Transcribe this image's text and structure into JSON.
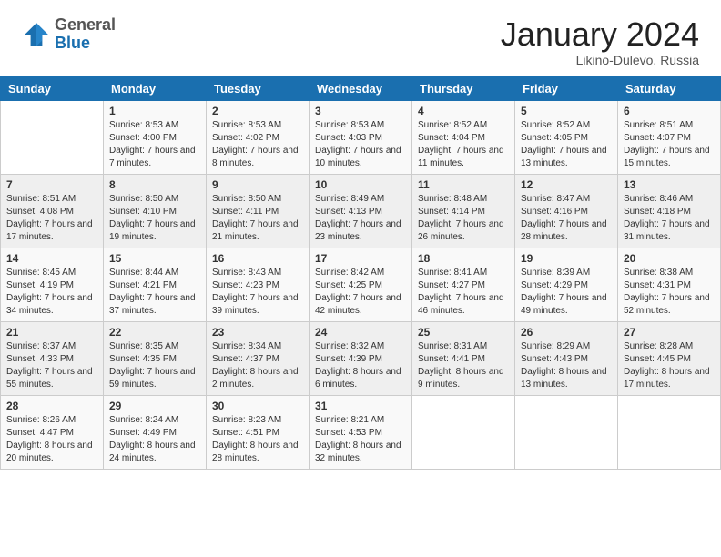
{
  "header": {
    "logo": {
      "general": "General",
      "blue": "Blue"
    },
    "title": "January 2024",
    "location": "Likino-Dulevo, Russia"
  },
  "days_of_week": [
    "Sunday",
    "Monday",
    "Tuesday",
    "Wednesday",
    "Thursday",
    "Friday",
    "Saturday"
  ],
  "weeks": [
    [
      {
        "day": "",
        "sunrise": "",
        "sunset": "",
        "daylight": ""
      },
      {
        "day": "1",
        "sunrise": "Sunrise: 8:53 AM",
        "sunset": "Sunset: 4:00 PM",
        "daylight": "Daylight: 7 hours and 7 minutes."
      },
      {
        "day": "2",
        "sunrise": "Sunrise: 8:53 AM",
        "sunset": "Sunset: 4:02 PM",
        "daylight": "Daylight: 7 hours and 8 minutes."
      },
      {
        "day": "3",
        "sunrise": "Sunrise: 8:53 AM",
        "sunset": "Sunset: 4:03 PM",
        "daylight": "Daylight: 7 hours and 10 minutes."
      },
      {
        "day": "4",
        "sunrise": "Sunrise: 8:52 AM",
        "sunset": "Sunset: 4:04 PM",
        "daylight": "Daylight: 7 hours and 11 minutes."
      },
      {
        "day": "5",
        "sunrise": "Sunrise: 8:52 AM",
        "sunset": "Sunset: 4:05 PM",
        "daylight": "Daylight: 7 hours and 13 minutes."
      },
      {
        "day": "6",
        "sunrise": "Sunrise: 8:51 AM",
        "sunset": "Sunset: 4:07 PM",
        "daylight": "Daylight: 7 hours and 15 minutes."
      }
    ],
    [
      {
        "day": "7",
        "sunrise": "Sunrise: 8:51 AM",
        "sunset": "Sunset: 4:08 PM",
        "daylight": "Daylight: 7 hours and 17 minutes."
      },
      {
        "day": "8",
        "sunrise": "Sunrise: 8:50 AM",
        "sunset": "Sunset: 4:10 PM",
        "daylight": "Daylight: 7 hours and 19 minutes."
      },
      {
        "day": "9",
        "sunrise": "Sunrise: 8:50 AM",
        "sunset": "Sunset: 4:11 PM",
        "daylight": "Daylight: 7 hours and 21 minutes."
      },
      {
        "day": "10",
        "sunrise": "Sunrise: 8:49 AM",
        "sunset": "Sunset: 4:13 PM",
        "daylight": "Daylight: 7 hours and 23 minutes."
      },
      {
        "day": "11",
        "sunrise": "Sunrise: 8:48 AM",
        "sunset": "Sunset: 4:14 PM",
        "daylight": "Daylight: 7 hours and 26 minutes."
      },
      {
        "day": "12",
        "sunrise": "Sunrise: 8:47 AM",
        "sunset": "Sunset: 4:16 PM",
        "daylight": "Daylight: 7 hours and 28 minutes."
      },
      {
        "day": "13",
        "sunrise": "Sunrise: 8:46 AM",
        "sunset": "Sunset: 4:18 PM",
        "daylight": "Daylight: 7 hours and 31 minutes."
      }
    ],
    [
      {
        "day": "14",
        "sunrise": "Sunrise: 8:45 AM",
        "sunset": "Sunset: 4:19 PM",
        "daylight": "Daylight: 7 hours and 34 minutes."
      },
      {
        "day": "15",
        "sunrise": "Sunrise: 8:44 AM",
        "sunset": "Sunset: 4:21 PM",
        "daylight": "Daylight: 7 hours and 37 minutes."
      },
      {
        "day": "16",
        "sunrise": "Sunrise: 8:43 AM",
        "sunset": "Sunset: 4:23 PM",
        "daylight": "Daylight: 7 hours and 39 minutes."
      },
      {
        "day": "17",
        "sunrise": "Sunrise: 8:42 AM",
        "sunset": "Sunset: 4:25 PM",
        "daylight": "Daylight: 7 hours and 42 minutes."
      },
      {
        "day": "18",
        "sunrise": "Sunrise: 8:41 AM",
        "sunset": "Sunset: 4:27 PM",
        "daylight": "Daylight: 7 hours and 46 minutes."
      },
      {
        "day": "19",
        "sunrise": "Sunrise: 8:39 AM",
        "sunset": "Sunset: 4:29 PM",
        "daylight": "Daylight: 7 hours and 49 minutes."
      },
      {
        "day": "20",
        "sunrise": "Sunrise: 8:38 AM",
        "sunset": "Sunset: 4:31 PM",
        "daylight": "Daylight: 7 hours and 52 minutes."
      }
    ],
    [
      {
        "day": "21",
        "sunrise": "Sunrise: 8:37 AM",
        "sunset": "Sunset: 4:33 PM",
        "daylight": "Daylight: 7 hours and 55 minutes."
      },
      {
        "day": "22",
        "sunrise": "Sunrise: 8:35 AM",
        "sunset": "Sunset: 4:35 PM",
        "daylight": "Daylight: 7 hours and 59 minutes."
      },
      {
        "day": "23",
        "sunrise": "Sunrise: 8:34 AM",
        "sunset": "Sunset: 4:37 PM",
        "daylight": "Daylight: 8 hours and 2 minutes."
      },
      {
        "day": "24",
        "sunrise": "Sunrise: 8:32 AM",
        "sunset": "Sunset: 4:39 PM",
        "daylight": "Daylight: 8 hours and 6 minutes."
      },
      {
        "day": "25",
        "sunrise": "Sunrise: 8:31 AM",
        "sunset": "Sunset: 4:41 PM",
        "daylight": "Daylight: 8 hours and 9 minutes."
      },
      {
        "day": "26",
        "sunrise": "Sunrise: 8:29 AM",
        "sunset": "Sunset: 4:43 PM",
        "daylight": "Daylight: 8 hours and 13 minutes."
      },
      {
        "day": "27",
        "sunrise": "Sunrise: 8:28 AM",
        "sunset": "Sunset: 4:45 PM",
        "daylight": "Daylight: 8 hours and 17 minutes."
      }
    ],
    [
      {
        "day": "28",
        "sunrise": "Sunrise: 8:26 AM",
        "sunset": "Sunset: 4:47 PM",
        "daylight": "Daylight: 8 hours and 20 minutes."
      },
      {
        "day": "29",
        "sunrise": "Sunrise: 8:24 AM",
        "sunset": "Sunset: 4:49 PM",
        "daylight": "Daylight: 8 hours and 24 minutes."
      },
      {
        "day": "30",
        "sunrise": "Sunrise: 8:23 AM",
        "sunset": "Sunset: 4:51 PM",
        "daylight": "Daylight: 8 hours and 28 minutes."
      },
      {
        "day": "31",
        "sunrise": "Sunrise: 8:21 AM",
        "sunset": "Sunset: 4:53 PM",
        "daylight": "Daylight: 8 hours and 32 minutes."
      },
      {
        "day": "",
        "sunrise": "",
        "sunset": "",
        "daylight": ""
      },
      {
        "day": "",
        "sunrise": "",
        "sunset": "",
        "daylight": ""
      },
      {
        "day": "",
        "sunrise": "",
        "sunset": "",
        "daylight": ""
      }
    ]
  ]
}
